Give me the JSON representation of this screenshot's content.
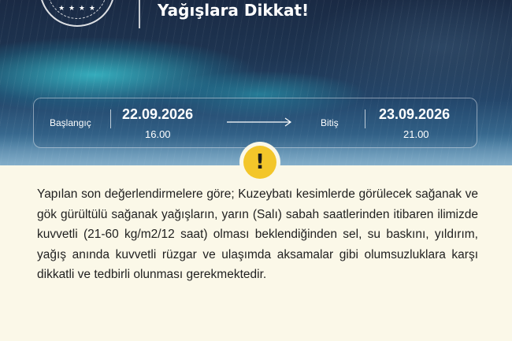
{
  "header": {
    "title": "Yağışlara Dikkat!",
    "logo_stars": "★ ★ ★ ★"
  },
  "period": {
    "start_label": "Başlangıç",
    "start_date": "22.09.2026",
    "start_time": "16.00",
    "end_label": "Bitiş",
    "end_date": "23.09.2026",
    "end_time": "21.00"
  },
  "warning": {
    "icon_symbol": "!",
    "icon_color": "#f3c62a",
    "message": "Yapılan son değerlendirmelere göre; Kuzeybatı kesimlerde görülecek sağanak ve gök gürültülü sağanak yağışların, yarın (Salı) sabah saatlerinden itibaren ilimizde kuvvetli (21-60 kg/m2/12 saat) olması beklendiğinden sel, su baskını, yıldırım, yağış anında kuvvetli rüzgar ve ulaşımda aksamalar gibi olumsuzluklara karşı dikkatli ve tedbirli olunması gerekmektedir."
  },
  "colors": {
    "background": "#fbf8e8",
    "hero_dark": "#1a2a44",
    "hero_glow": "#3cd2dc",
    "text": "#1f1f1f"
  }
}
